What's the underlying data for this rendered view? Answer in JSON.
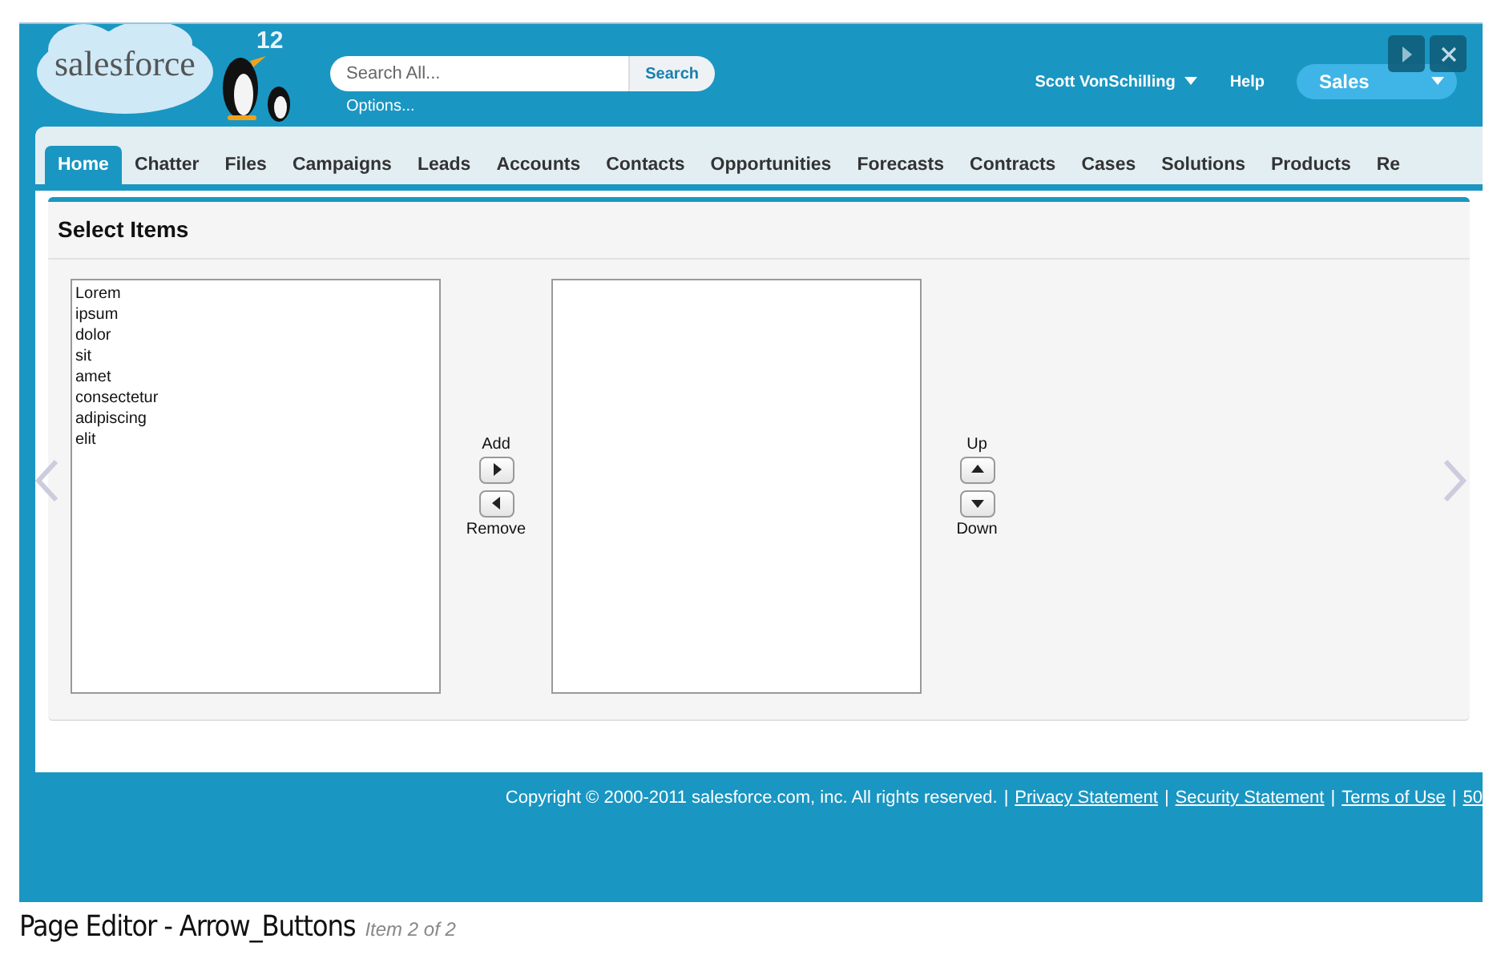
{
  "header": {
    "logo": "salesforce",
    "release": "12",
    "search": {
      "placeholder": "Search All...",
      "button": "Search"
    },
    "options_link": "Options...",
    "user_menu": "Scott VonSchilling",
    "help": "Help",
    "app_menu": "Sales"
  },
  "tabs": [
    {
      "label": "Home",
      "selected": true
    },
    {
      "label": "Chatter",
      "selected": false
    },
    {
      "label": "Files",
      "selected": false
    },
    {
      "label": "Campaigns",
      "selected": false
    },
    {
      "label": "Leads",
      "selected": false
    },
    {
      "label": "Accounts",
      "selected": false
    },
    {
      "label": "Contacts",
      "selected": false
    },
    {
      "label": "Opportunities",
      "selected": false
    },
    {
      "label": "Forecasts",
      "selected": false
    },
    {
      "label": "Contracts",
      "selected": false
    },
    {
      "label": "Cases",
      "selected": false
    },
    {
      "label": "Solutions",
      "selected": false
    },
    {
      "label": "Products",
      "selected": false
    },
    {
      "label": "Re",
      "selected": false
    }
  ],
  "section": {
    "title": "Select Items",
    "available": [
      "Lorem",
      "ipsum",
      "dolor",
      "sit",
      "amet",
      "consectetur",
      "adipiscing",
      "elit"
    ],
    "add_label": "Add",
    "remove_label": "Remove",
    "up_label": "Up",
    "down_label": "Down"
  },
  "footer": {
    "copyright": "Copyright © 2000-2011 salesforce.com, inc. All rights reserved.",
    "separator": "|",
    "links": [
      "Privacy Statement",
      "Security Statement",
      "Terms of Use",
      "50"
    ]
  },
  "caption": {
    "title": "Page Editor - Arrow_Buttons",
    "counter": "Item 2 of 2"
  }
}
